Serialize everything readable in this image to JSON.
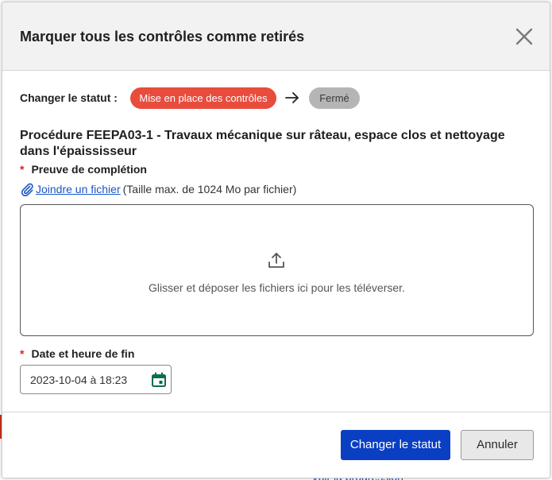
{
  "background": {
    "link_text": "Voir la progression"
  },
  "modal": {
    "title": "Marquer tous les contrôles comme retirés",
    "close_icon": "close-icon"
  },
  "status": {
    "label": "Changer le statut :",
    "current": "Mise en place des contrôles",
    "next": "Fermé",
    "current_color": "#e84c3d",
    "next_color": "#b5b5b5",
    "arrow_icon": "arrow-right-icon"
  },
  "procedure": {
    "title": "Procédure FEEPA03-1 - Travaux mécanique sur râteau, espace clos et nettoyage dans l'épaississeur"
  },
  "proof": {
    "required_marker": "*",
    "label": "Preuve de complétion",
    "attach_link": "Joindre un fichier",
    "attach_hint": "(Taille max. de 1024 Mo par fichier)",
    "attach_icon": "paperclip-icon",
    "dropzone_text": "Glisser et déposer les fichiers ici pour les téléverser.",
    "upload_icon": "upload-icon"
  },
  "end_date": {
    "required_marker": "*",
    "label": "Date et heure de fin",
    "value": "2023-10-04 à 18:23",
    "calendar_icon": "calendar-icon"
  },
  "buttons": {
    "primary": "Changer le statut",
    "secondary": "Annuler",
    "primary_color": "#0a3fc4"
  }
}
